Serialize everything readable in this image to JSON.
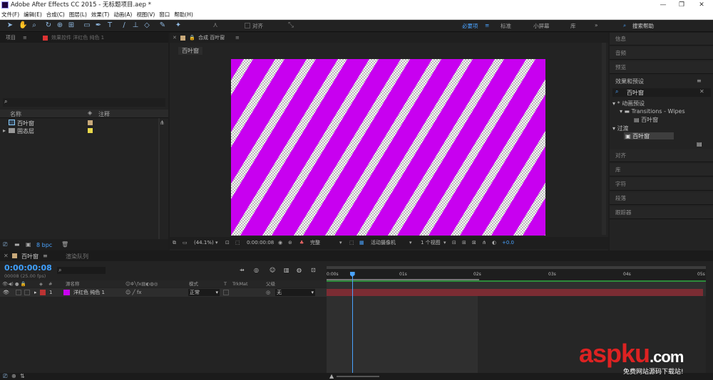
{
  "window": {
    "title": "Adobe After Effects CC 2015 - 无标题项目.aep *",
    "minimize": "—",
    "maximize": "❐",
    "close": "✕"
  },
  "menu": [
    "文件(F)",
    "编辑(E)",
    "合成(C)",
    "图层(L)",
    "效果(T)",
    "动画(A)",
    "视图(V)",
    "窗口",
    "帮助(H)"
  ],
  "toolbar": {
    "align_label": "对齐",
    "workspaces": [
      "必要项",
      "标准",
      "小屏幕",
      "库"
    ],
    "search_help": "搜索帮助"
  },
  "project": {
    "tab_label": "项目",
    "effect_controls_tab": "效果控件 洋红色 纯色 1",
    "search_placeholder": "",
    "columns": {
      "name": "名称",
      "comment": "注释"
    },
    "items": [
      {
        "name": "百叶窗",
        "color": "#c8a97a"
      },
      {
        "name": "固态层",
        "color": "#e8d84a"
      }
    ],
    "bpc": "8 bpc"
  },
  "comp": {
    "tab_label": "合成 百叶窗",
    "subtab": "百叶窗",
    "zoom": "(44.1%)",
    "timecode": "0:00:00:08",
    "quality": "完整",
    "camera": "活动摄像机",
    "views": "1 个视图",
    "exposure": "+0.0",
    "bg_color": "#c800f0"
  },
  "right_panels": {
    "top": [
      "信息",
      "音频",
      "预览"
    ],
    "effects_title": "效果和预设",
    "search_value": "百叶窗",
    "tree": [
      {
        "label": "* 动画预设",
        "level": 0
      },
      {
        "label": "Transitions - Wipes",
        "level": 1
      },
      {
        "label": "百叶窗",
        "level": 2
      },
      {
        "label": "过渡",
        "level": 0
      },
      {
        "label": "百叶窗",
        "level": 1
      }
    ],
    "bottom": [
      "对齐",
      "库",
      "字符",
      "段落",
      "跟踪器"
    ]
  },
  "timeline": {
    "tab_label": "百叶窗",
    "render_queue_tab": "渲染队列",
    "timecode": "0:00:00:08",
    "frame_info": "00008 (25.00 fps)",
    "columns": {
      "num": "#",
      "source": "源名称",
      "mode": "模式",
      "t": "T",
      "trkmat": "TrkMat",
      "parent": "父级"
    },
    "layers": [
      {
        "num": "1",
        "name": "洋红色 纯色 1",
        "mode": "正常",
        "parent": "无",
        "color": "#c800f0"
      }
    ],
    "ruler_labels": [
      "0:00s",
      "01s",
      "02s",
      "03s",
      "04s",
      "05s"
    ],
    "playhead_fraction": 0.067
  }
}
